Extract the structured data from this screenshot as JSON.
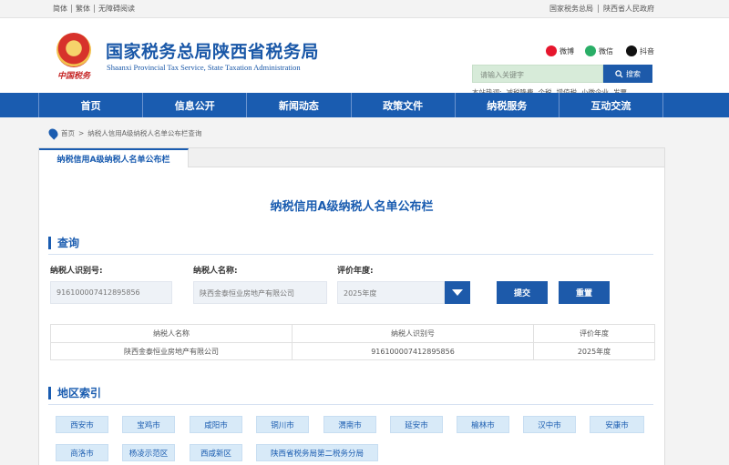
{
  "topbar": {
    "left": [
      "简体",
      "繁体",
      "无障碍阅读"
    ],
    "right": [
      "国家税务总局",
      "陕西省人民政府"
    ]
  },
  "header": {
    "emblem_caption": "中国税务",
    "title": "国家税务总局陕西省税务局",
    "subtitle": "Shaanxi Provincial Tax Service, State Taxation Administration",
    "social": {
      "weibo": "微博",
      "wechat": "微信",
      "douyin": "抖音"
    },
    "search": {
      "placeholder": "请输入关键字",
      "button": "搜索"
    },
    "hot": {
      "label": "本站热词:",
      "terms": [
        "减税降费",
        "个税",
        "增值税",
        "小微企业",
        "发票"
      ]
    }
  },
  "nav": [
    "首页",
    "信息公开",
    "新闻动态",
    "政策文件",
    "纳税服务",
    "互动交流"
  ],
  "breadcrumb": {
    "home": "首页",
    "sep": ">",
    "current": "纳税人信用A级纳税人名单公布栏查询"
  },
  "panel": {
    "tab": "纳税信用A级纳税人名单公布栏",
    "heading": "纳税信用A级纳税人名单公布栏",
    "query_title": "查询",
    "fields": {
      "id_label": "纳税人识别号:",
      "id_value": "916100007412895856",
      "name_label": "纳税人名称:",
      "name_value": "陕西金泰恒业房地产有限公司",
      "year_label": "评价年度:",
      "year_value": "2025年度"
    },
    "submit": "提交",
    "reset": "重置",
    "table": {
      "headers": [
        "纳税人名称",
        "纳税人识别号",
        "评价年度"
      ],
      "rows": [
        [
          "陕西金泰恒业房地产有限公司",
          "916100007412895856",
          "2025年度"
        ]
      ]
    },
    "region_title": "地区索引",
    "regions": [
      "西安市",
      "宝鸡市",
      "咸阳市",
      "铜川市",
      "渭南市",
      "延安市",
      "榆林市",
      "汉中市",
      "安康市",
      "商洛市",
      "杨凌示范区",
      "西咸新区",
      "陕西省税务局第二税务分局"
    ]
  }
}
